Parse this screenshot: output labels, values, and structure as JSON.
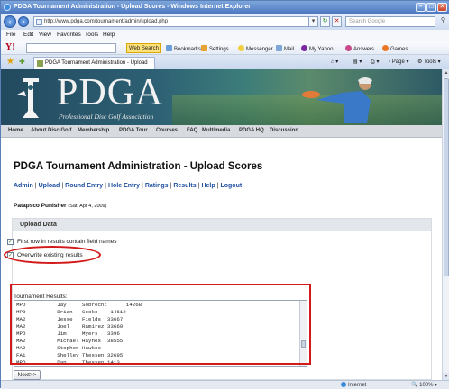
{
  "window": {
    "title": "PDGA Tournament Administration - Upload Scores - Windows Internet Explorer",
    "minimize": "–",
    "maximize": "□",
    "close": "✕"
  },
  "address": {
    "url": "http://www.pdga.com/tournament/admin/upload.php",
    "search_placeholder": "Search Google"
  },
  "menu": [
    "File",
    "Edit",
    "View",
    "Favorites",
    "Tools",
    "Help"
  ],
  "yahoo_toolbar": {
    "logo": "Y!",
    "web_search": "Web Search",
    "items": [
      "Bookmarks",
      "Settings",
      "Messenger",
      "Mail",
      "My Yahoo!",
      "Answers",
      "Games"
    ]
  },
  "tab": {
    "title": "PDGA Tournament Administration - Upload Scores",
    "tools": [
      "Page",
      "Tools"
    ]
  },
  "banner": {
    "logo_text": "PDGA",
    "subtitle": "Professional Disc Golf Association"
  },
  "site_nav": [
    "Home",
    "About Disc Golf",
    "Membership",
    "PDGA Tour",
    "Courses",
    "FAQ",
    "Multimedia",
    "PDGA HQ",
    "Discussion"
  ],
  "page": {
    "heading": "PDGA Tournament Administration - Upload Scores",
    "links": [
      "Admin",
      "Upload",
      "Round Entry",
      "Hole Entry",
      "Ratings",
      "Results",
      "Help",
      "Logout"
    ],
    "event_name": "Patapsco Punisher",
    "event_date": "(Sat, Apr 4, 2009)"
  },
  "upload_box": {
    "header": "Upload Data",
    "first_row_label": "First row in results contain field names",
    "overwrite_label": "Overwrite existing results",
    "results_label": "Tournament Results:",
    "rows": [
      "MPO          Jay     Sobrecht      14268",
      "MPO          Brian   Cooke    14612",
      "MA2          Jesse   Fields  33667",
      "MA2          Joel    Ramirez 33669",
      "MPO          Jim     Myers   3396",
      "MA2          Michael Haynes  38555",
      "MA2          Stephen Hawkes",
      "FA1          Shelley Thessen 32695",
      "MPO          Dan     Thessen 1413"
    ],
    "next_button": "Next>>"
  },
  "status": {
    "zone": "Internet",
    "zoom": "100%"
  }
}
